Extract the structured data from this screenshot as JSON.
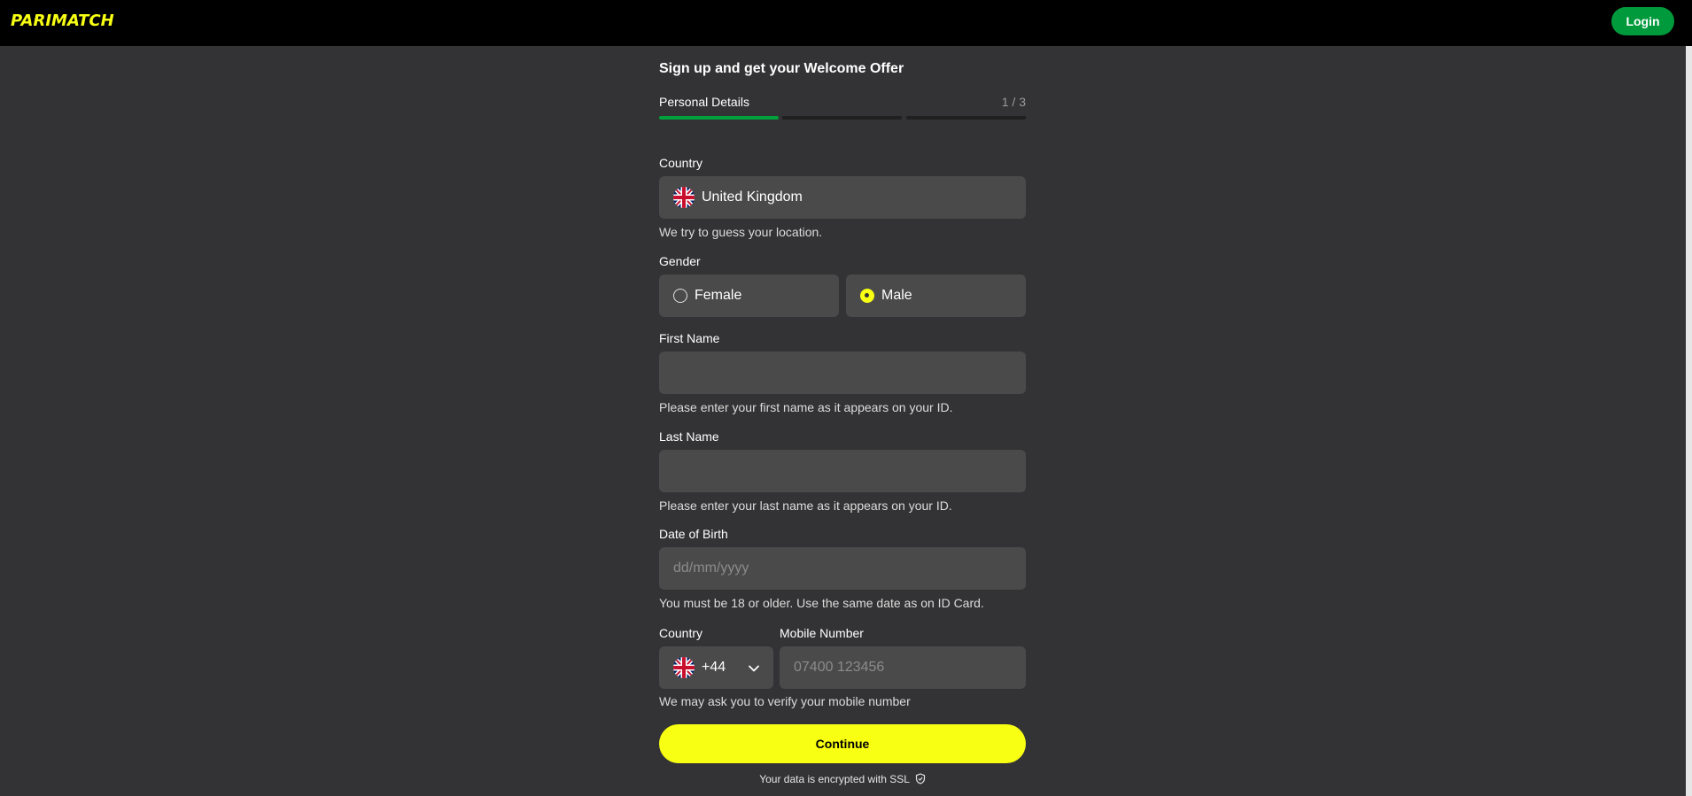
{
  "header": {
    "logo_text": "PARIMATCH",
    "login_label": "Login"
  },
  "form": {
    "headline": "Sign up and get your Welcome Offer",
    "step_label": "Personal Details",
    "step_count": "1 / 3",
    "progress_fraction": 1,
    "country": {
      "label": "Country",
      "value": "United Kingdom",
      "flag": "uk-flag-icon",
      "hint": "We try to guess your location."
    },
    "gender": {
      "label": "Gender",
      "options": [
        {
          "label": "Female",
          "selected": false
        },
        {
          "label": "Male",
          "selected": true
        }
      ]
    },
    "first_name": {
      "label": "First Name",
      "value": "",
      "hint": "Please enter your first name as it appears on your ID."
    },
    "last_name": {
      "label": "Last Name",
      "value": "",
      "hint": "Please enter your last name as it appears on your ID."
    },
    "dob": {
      "label": "Date of Birth",
      "placeholder": "dd/mm/yyyy",
      "hint": "You must be 18 or older. Use the same date as on ID Card."
    },
    "phone": {
      "country_label": "Country",
      "number_label": "Mobile Number",
      "country_code": "+44",
      "placeholder": "07400 123456",
      "hint": "We may ask you to verify your mobile number"
    },
    "continue_label": "Continue",
    "ssl_text": "Your data is encrypted with SSL"
  },
  "colors": {
    "brand_yellow": "#f8ff13",
    "brand_green": "#00a03c",
    "background": "#333335",
    "field": "#4a4a4b"
  }
}
